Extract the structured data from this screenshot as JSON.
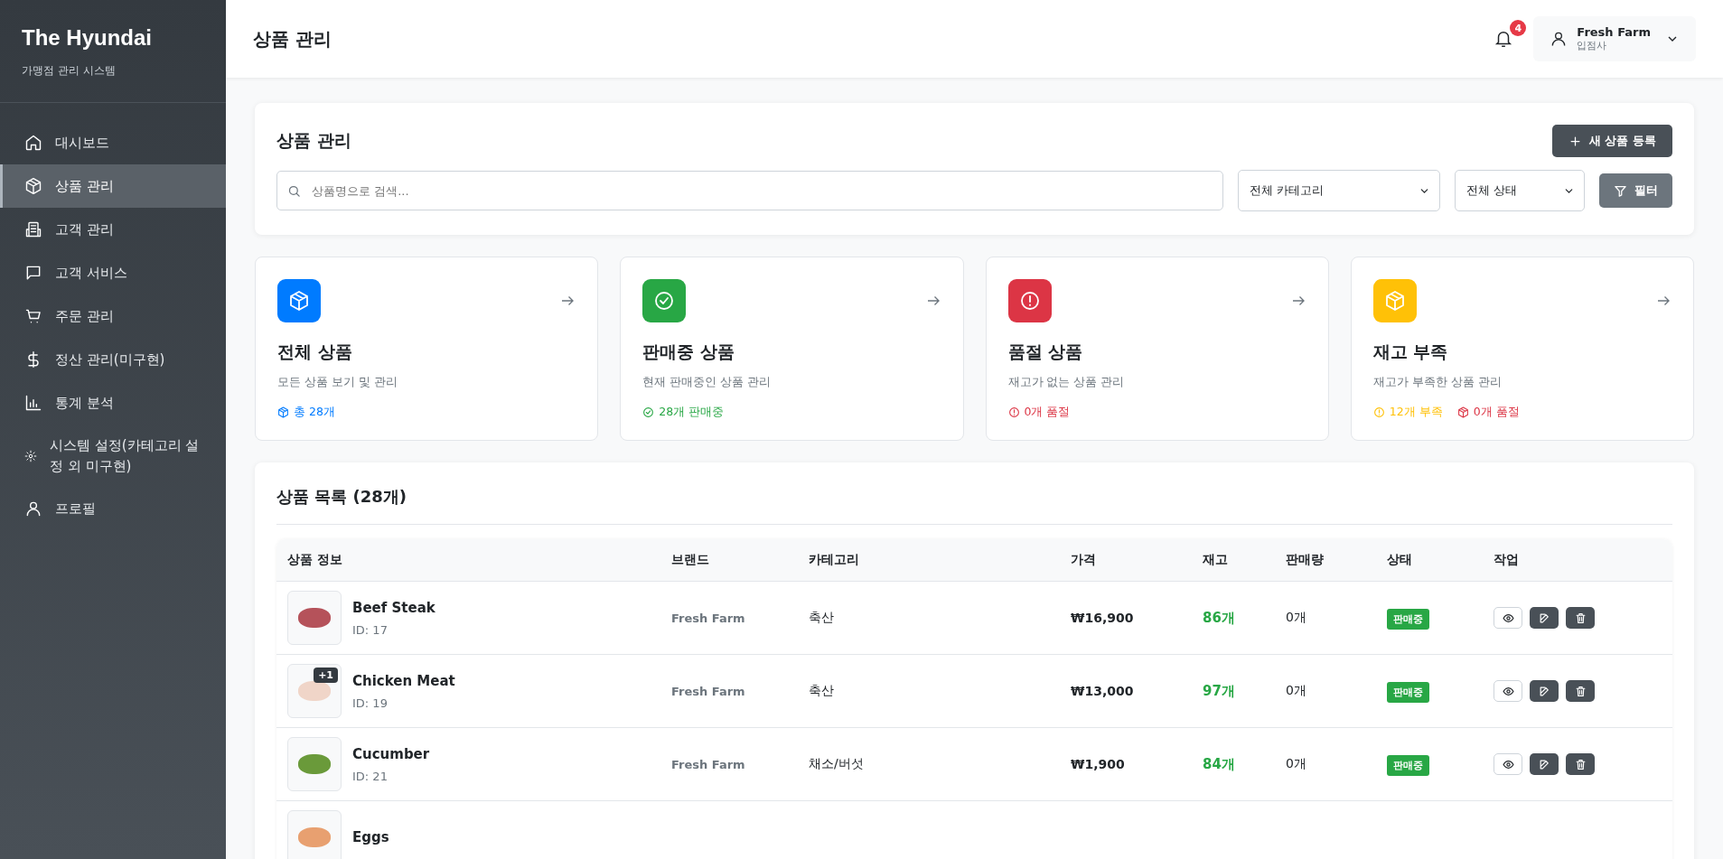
{
  "sidebar": {
    "brand": "The Hyundai",
    "subtitle": "가맹점 관리 시스템",
    "items": [
      {
        "label": "대시보드",
        "selected": false
      },
      {
        "label": "상품 관리",
        "selected": true
      },
      {
        "label": "고객 관리",
        "selected": false
      },
      {
        "label": "고객 서비스",
        "selected": false
      },
      {
        "label": "주문 관리",
        "selected": false
      },
      {
        "label": "정산 관리(미구현)",
        "selected": false
      },
      {
        "label": "통계 분석",
        "selected": false
      },
      {
        "label": "시스템 설정(카테고리 설정 외 미구현)",
        "selected": false
      },
      {
        "label": "프로필",
        "selected": false
      }
    ]
  },
  "header": {
    "title": "상품 관리",
    "notifications": "4",
    "user": {
      "name": "Fresh Farm",
      "role": "입점사"
    }
  },
  "toolbar": {
    "title": "상품 관리",
    "new_button": "새 상품 등록",
    "search": {
      "placeholder": "상품명으로 검색..."
    },
    "category_select": "전체 카테고리",
    "status_select": "전체 상태",
    "filter_button": "필터"
  },
  "cards": [
    {
      "color": "#007bff",
      "title": "전체 상품",
      "description": "모든 상품 보기 및 관리",
      "stats": [
        {
          "text": "총 28개",
          "color": "#007bff"
        }
      ]
    },
    {
      "color": "#28a745",
      "title": "판매중 상품",
      "description": "현재 판매중인 상품 관리",
      "stats": [
        {
          "text": "28개 판매중",
          "color": "#28a745"
        }
      ]
    },
    {
      "color": "#dc3545",
      "title": "품절 상품",
      "description": "재고가 없는 상품 관리",
      "stats": [
        {
          "text": "0개 품절",
          "color": "#dc3545"
        }
      ]
    },
    {
      "color": "#ffc107",
      "title": "재고 부족",
      "description": "재고가 부족한 상품 관리",
      "stats": [
        {
          "text": "12개 부족",
          "color": "#ffc107"
        },
        {
          "text": "0개 품절",
          "color": "#dc3545"
        }
      ]
    }
  ],
  "product_list": {
    "title": "상품 목록 (28개)",
    "columns": [
      "상품 정보",
      "브랜드",
      "카테고리",
      "가격",
      "재고",
      "판매량",
      "상태",
      "작업"
    ],
    "rows": [
      {
        "name": "Beef Steak",
        "id": "ID: 17",
        "brand": "Fresh Farm",
        "category": "축산",
        "price": "₩16,900",
        "stock": "86개",
        "sales": "0개",
        "status": {
          "label": "판매중",
          "color": "#28a745"
        }
      },
      {
        "extra_images": "+1",
        "name": "Chicken Meat",
        "id": "ID: 19",
        "brand": "Fresh Farm",
        "category": "축산",
        "price": "₩13,000",
        "stock": "97개",
        "sales": "0개",
        "status": {
          "label": "판매중",
          "color": "#28a745"
        }
      },
      {
        "name": "Cucumber",
        "id": "ID: 21",
        "brand": "Fresh Farm",
        "category": "채소/버섯",
        "price": "₩1,900",
        "stock": "84개",
        "sales": "0개",
        "status": {
          "label": "판매중",
          "color": "#28a745"
        }
      },
      {
        "name": "Eggs"
      }
    ]
  }
}
